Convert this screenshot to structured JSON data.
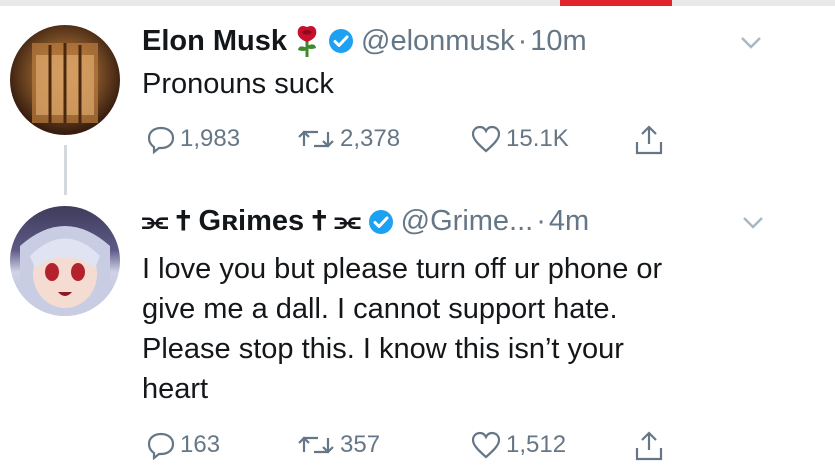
{
  "tweets": [
    {
      "name": "Elon Musk",
      "handle": "@elonmusk",
      "separator": "·",
      "time": "10m",
      "text": "Pronouns suck",
      "replies": "1,983",
      "retweets": "2,378",
      "likes": "15.1K",
      "icons": [
        "rose-icon",
        "verified-icon",
        "chevron-down-icon",
        "reply-icon",
        "retweet-icon",
        "heart-icon",
        "share-icon"
      ]
    },
    {
      "name": "⫘ ✝ Gʀimes ✝ ⫘",
      "handle": "@Grime...",
      "separator": "·",
      "time": "4m",
      "text": "I love you but please turn off ur phone or\ngive me a dall.  I cannot support hate.\nPlease stop this. I know this isn’t your\nheart",
      "replies": "163",
      "retweets": "357",
      "likes": "1,512",
      "icons": [
        "verified-icon",
        "chevron-down-icon",
        "reply-icon",
        "retweet-icon",
        "heart-icon",
        "share-icon"
      ]
    }
  ],
  "colors": {
    "text": "#14171a",
    "muted": "#657786",
    "verified": "#1da1f2",
    "topbar_accent": "#e0262b"
  }
}
